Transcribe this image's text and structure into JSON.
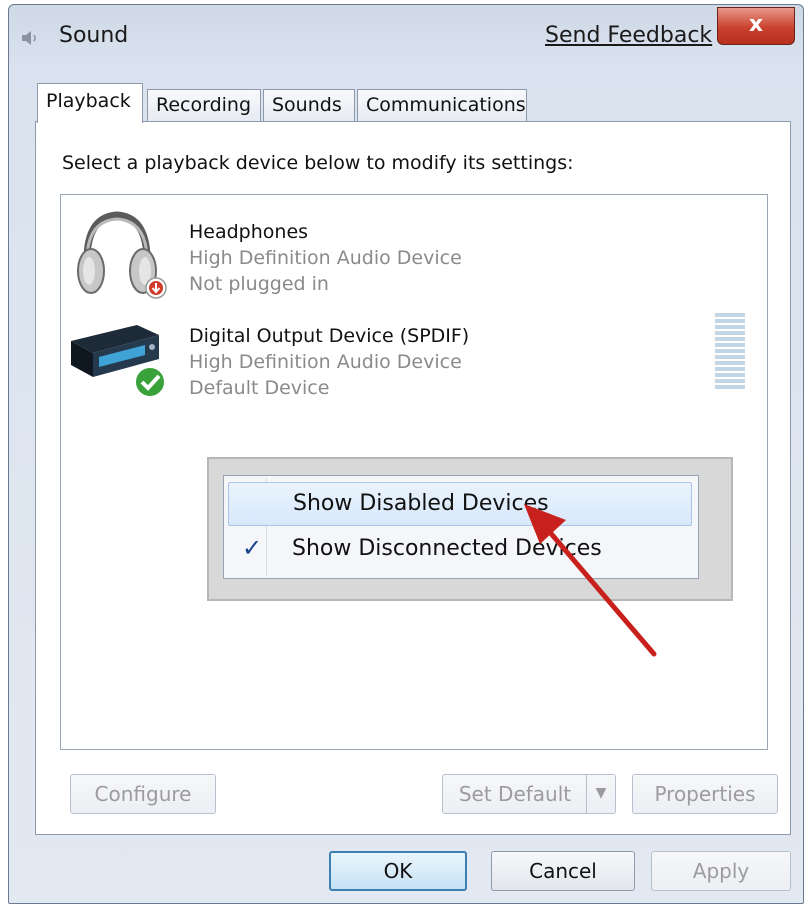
{
  "window": {
    "title": "Sound",
    "send_feedback": "Send Feedback",
    "close_glyph": "x"
  },
  "tabs": [
    {
      "label": "Playback",
      "active": true
    },
    {
      "label": "Recording",
      "active": false
    },
    {
      "label": "Sounds",
      "active": false
    },
    {
      "label": "Communications",
      "active": false
    }
  ],
  "playback": {
    "instruction": "Select a playback device below to modify its settings:",
    "devices": [
      {
        "name": "Headphones",
        "description": "High Definition Audio Device",
        "status": "Not plugged in",
        "icon": "headphones-icon",
        "status_icon": "red-down-arrow-badge"
      },
      {
        "name": "Digital Output Device (SPDIF)",
        "description": "High Definition Audio Device",
        "status": "Default Device",
        "icon": "digital-output-device-icon",
        "status_icon": "green-check-badge"
      }
    ]
  },
  "context_menu": {
    "items": [
      {
        "label": "Show Disabled Devices",
        "checked": false,
        "hovered": true
      },
      {
        "label": "Show Disconnected Devices",
        "checked": true,
        "hovered": false
      }
    ],
    "check_glyph": "✓"
  },
  "panel_buttons": {
    "configure": "Configure",
    "set_default": "Set Default",
    "properties": "Properties"
  },
  "dialog_buttons": {
    "ok": "OK",
    "cancel": "Cancel",
    "apply": "Apply"
  },
  "colors": {
    "accent": "#3c7fb1",
    "close_red": "#c9412d",
    "annotation_arrow": "#c8201c",
    "default_check_green": "#3aa23a"
  }
}
